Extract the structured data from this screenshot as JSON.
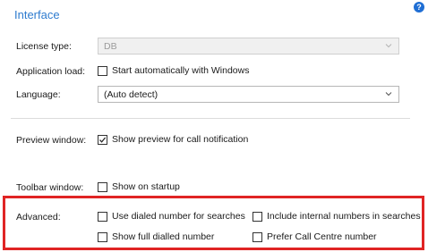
{
  "section": {
    "title": "Interface"
  },
  "help_icon": {
    "glyph": "?"
  },
  "license_type": {
    "label": "License type:",
    "value": "DB"
  },
  "application_load": {
    "label": "Application load:",
    "checkbox_label": "Start automatically with Windows",
    "checked": false
  },
  "language": {
    "label": "Language:",
    "value": "(Auto detect)"
  },
  "preview_window": {
    "label": "Preview window:",
    "checkbox_label": "Show preview for call notification",
    "checked": true
  },
  "toolbar_window": {
    "label": "Toolbar window:",
    "checkbox_label": "Show on startup",
    "checked": false
  },
  "advanced": {
    "label": "Advanced:",
    "options": [
      {
        "label": "Use dialed number for searches",
        "checked": false
      },
      {
        "label": "Include internal numbers in searches",
        "checked": false
      },
      {
        "label": "Show full dialled number",
        "checked": false
      },
      {
        "label": "Prefer Call Centre number",
        "checked": false
      }
    ]
  },
  "colors": {
    "accent": "#2e7bcf",
    "help": "#1f6ed4",
    "highlight": "#e02424"
  }
}
